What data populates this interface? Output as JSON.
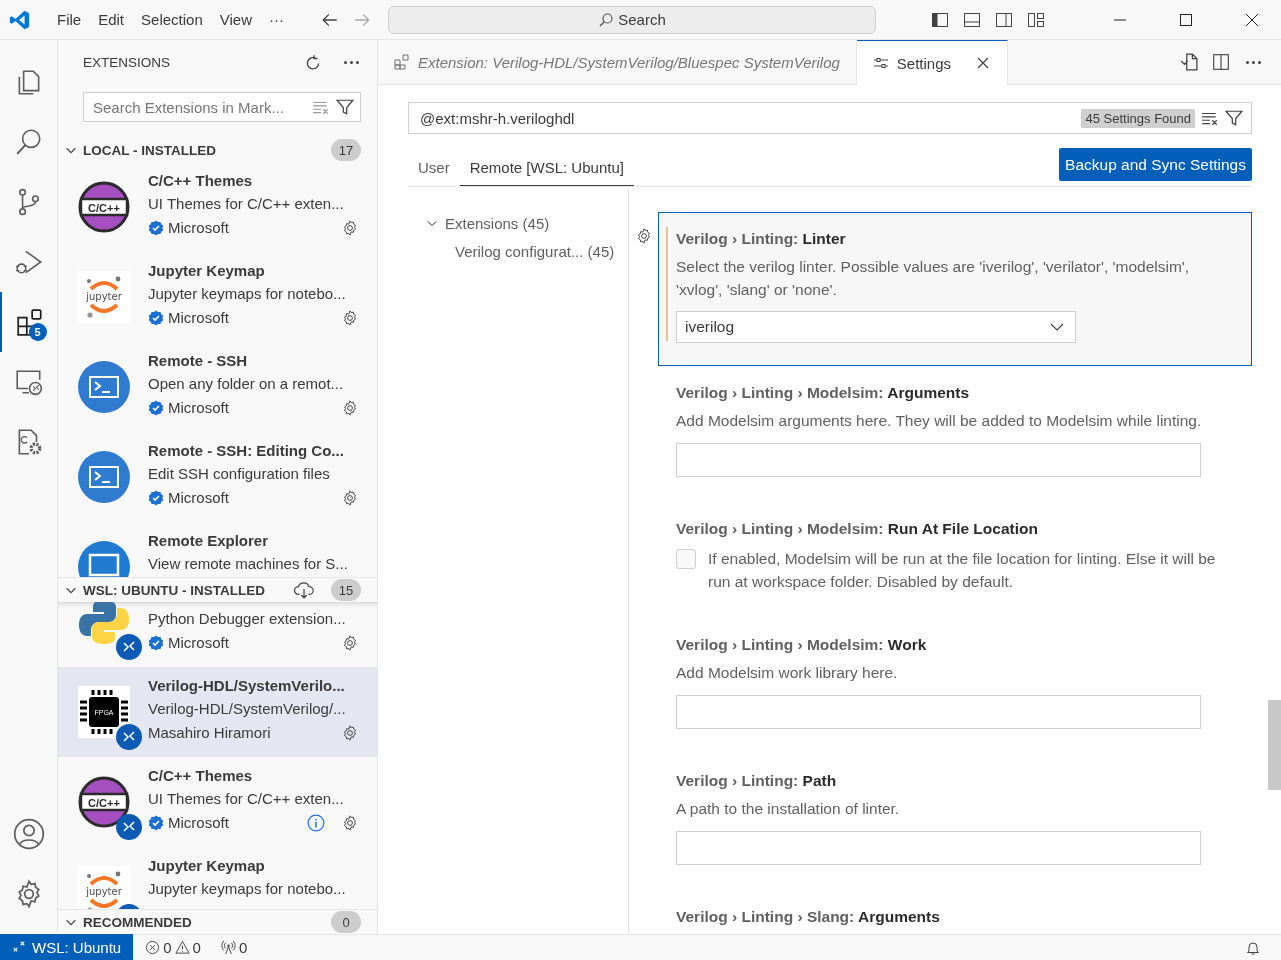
{
  "titlebar": {
    "menus": [
      "File",
      "Edit",
      "Selection",
      "View",
      "···"
    ],
    "command_center": {
      "placeholder": "Search"
    }
  },
  "activity_bar": {
    "items": [
      {
        "kind": "explorer",
        "selected": false
      },
      {
        "kind": "search",
        "selected": false
      },
      {
        "kind": "scm",
        "selected": false
      },
      {
        "kind": "debug",
        "selected": false
      },
      {
        "kind": "extensions",
        "selected": true,
        "badge": "5"
      },
      {
        "kind": "remote",
        "selected": false
      },
      {
        "kind": "cpp-config",
        "selected": false
      }
    ],
    "bottom": [
      {
        "kind": "account"
      },
      {
        "kind": "manage"
      }
    ]
  },
  "sidebar": {
    "title": "EXTENSIONS",
    "search": {
      "placeholder": "Search Extensions in Mark..."
    },
    "sections": [
      {
        "title": "LOCAL - INSTALLED",
        "count": "17",
        "expanded": true,
        "install_action": false,
        "items": [
          {
            "title": "C/C++ Themes",
            "description": "UI Themes for C/C++ exten...",
            "publisher": "Microsoft",
            "verified": true,
            "kind": "cpp",
            "logo_text": "C/C++",
            "remote": false,
            "selected": false,
            "info": false
          },
          {
            "title": "Jupyter Keymap",
            "description": "Jupyter keymaps for notebo...",
            "publisher": "Microsoft",
            "verified": true,
            "kind": "jupyter",
            "logo_text": "jupyter",
            "remote": false,
            "selected": false,
            "info": false
          },
          {
            "title": "Remote - SSH",
            "description": "Open any folder on a remot...",
            "publisher": "Microsoft",
            "verified": true,
            "kind": "terminal",
            "remote": false,
            "selected": false,
            "info": false
          },
          {
            "title": "Remote - SSH: Editing Co...",
            "description": "Edit SSH configuration files",
            "publisher": "Microsoft",
            "verified": true,
            "kind": "terminal",
            "remote": false,
            "selected": false,
            "info": false
          },
          {
            "title": "Remote Explorer",
            "description": "View remote machines for S...",
            "kind": "monitor",
            "remote": false,
            "selected": false,
            "info": false
          }
        ]
      },
      {
        "title": "WSL: UBUNTU - INSTALLED",
        "count": "15",
        "expanded": true,
        "install_action": true,
        "items": [
          {
            "description": "Python Debugger extension...",
            "publisher": "Microsoft",
            "verified": true,
            "kind": "python",
            "remote": true,
            "selected": false,
            "info": false
          },
          {
            "title": "Verilog-HDL/SystemVerilo...",
            "description": "Verilog-HDL/SystemVerilog/...",
            "publisher": "Masahiro Hiramori",
            "verified": false,
            "kind": "fpga",
            "logo_text": "FPGA",
            "remote": true,
            "selected": true,
            "info": false
          },
          {
            "title": "C/C++ Themes",
            "description": "UI Themes for C/C++ exten...",
            "publisher": "Microsoft",
            "verified": true,
            "kind": "cpp",
            "logo_text": "C/C++",
            "remote": true,
            "selected": false,
            "info": true
          },
          {
            "title": "Jupyter Keymap",
            "description": "Jupyter keymaps for notebo...",
            "kind": "jupyter",
            "logo_text": "jupyter",
            "remote": true,
            "selected": false,
            "info": false
          }
        ]
      },
      {
        "title": "RECOMMENDED",
        "count": "0",
        "expanded": true,
        "install_action": false
      }
    ]
  },
  "editor": {
    "tabs": [
      {
        "label": "Extension: Verilog-HDL/SystemVerilog/Bluespec SystemVerilog",
        "kind": "extension",
        "preview": true,
        "selected": false
      },
      {
        "label": "Settings",
        "kind": "settings",
        "preview": false,
        "selected": true
      }
    ],
    "settings": {
      "search": {
        "value": "@ext:mshr-h.veriloghdl",
        "count": "45 Settings Found"
      },
      "scopes": [
        {
          "label": "User",
          "selected": false
        },
        {
          "label": "Remote [WSL: Ubuntu]",
          "selected": true
        }
      ],
      "sync_button": "Backup and Sync Settings",
      "toc": [
        {
          "label": "Extensions",
          "count": "(45)",
          "expanded": true,
          "children": [
            {
              "label": "Verilog configurat...",
              "count": "(45)"
            }
          ]
        }
      ],
      "items": [
        {
          "category": "Verilog › Linting:",
          "name": "Linter",
          "description": "Select the verilog linter. Possible values are 'iverilog', 'verilator', 'modelsim', 'xvlog', 'slang' or 'none'.",
          "kind": "select",
          "value": "iverilog",
          "focused": true,
          "modified": true
        },
        {
          "category": "Verilog › Linting › Modelsim:",
          "name": "Arguments",
          "description": "Add Modelsim arguments here. They will be added to Modelsim while linting.",
          "kind": "text",
          "focused": false,
          "modified": false
        },
        {
          "category": "Verilog › Linting › Modelsim:",
          "name": "Run At File Location",
          "description": "If enabled, Modelsim will be run at the file location for linting. Else it will be run at workspace folder. Disabled by default.",
          "kind": "checkbox",
          "checked": false,
          "focused": false,
          "modified": false
        },
        {
          "category": "Verilog › Linting › Modelsim:",
          "name": "Work",
          "description": "Add Modelsim work library here.",
          "kind": "text",
          "focused": false,
          "modified": false
        },
        {
          "category": "Verilog › Linting:",
          "name": "Path",
          "description": "A path to the installation of linter.",
          "kind": "text",
          "focused": false,
          "modified": false
        },
        {
          "category": "Verilog › Linting › Slang:",
          "name": "Arguments",
          "focused": false,
          "modified": false
        }
      ]
    }
  },
  "status_bar": {
    "remote": "WSL: Ubuntu",
    "errors": "0",
    "warnings": "0",
    "ports": "0"
  }
}
